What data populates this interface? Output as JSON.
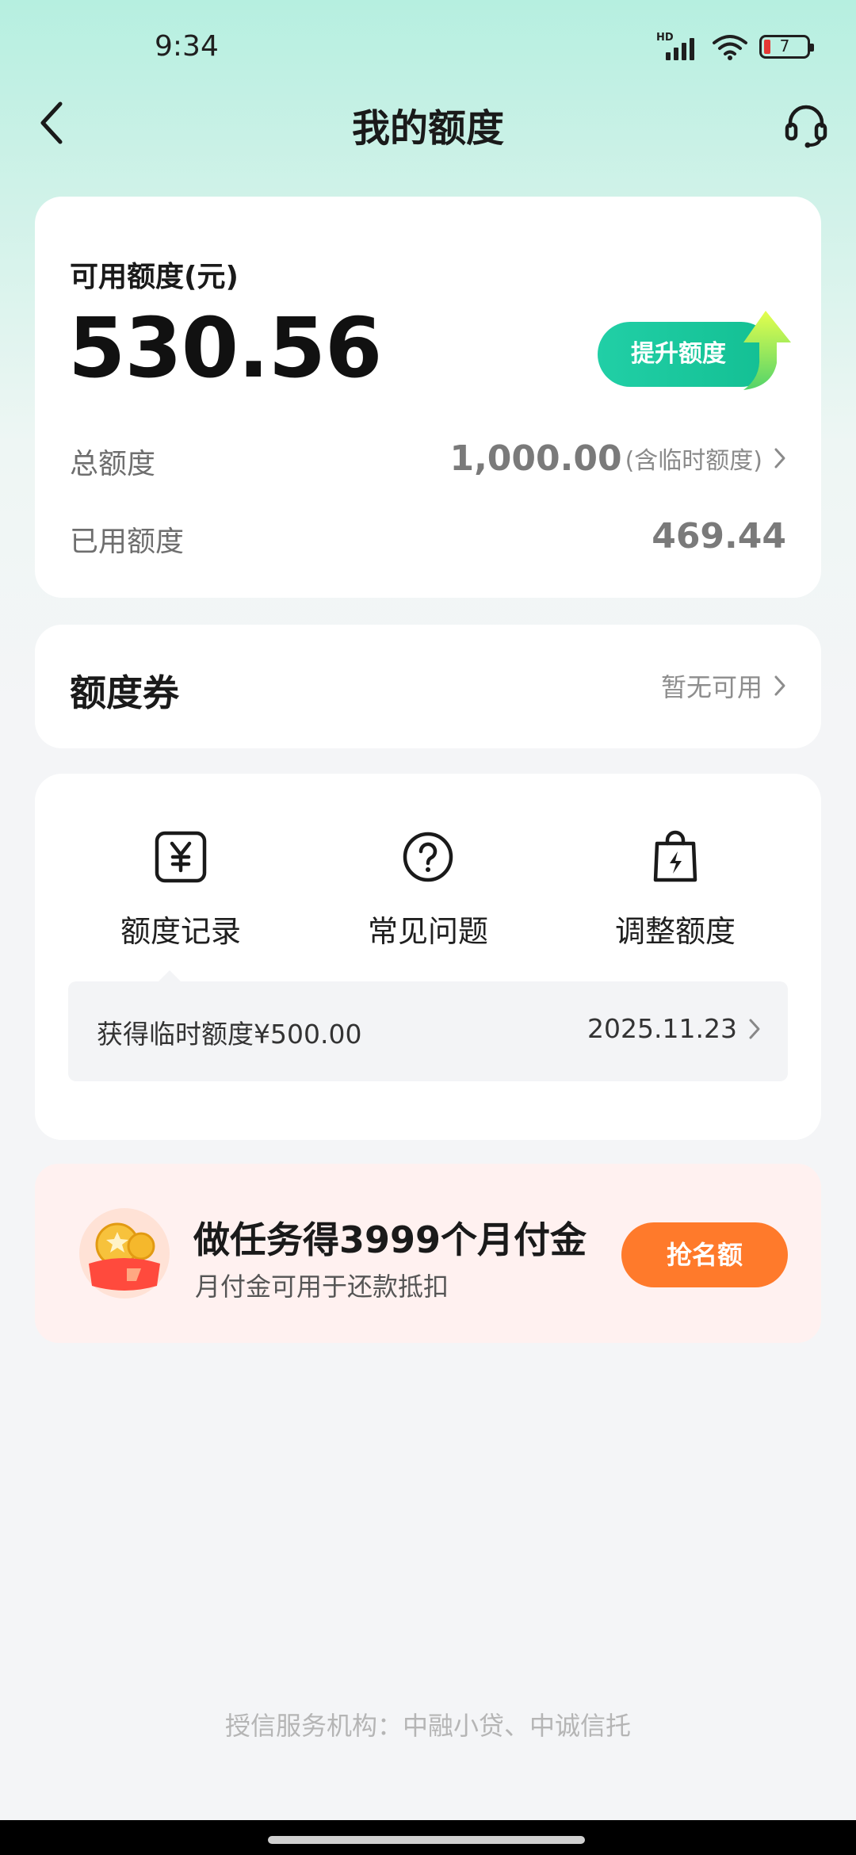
{
  "status_bar": {
    "time": "9:34",
    "network_label": "HD",
    "battery_level": "7",
    "battery_color": "#e53935"
  },
  "nav": {
    "title": "我的额度",
    "back_icon": "chevron-left-icon",
    "service_icon": "headset-icon"
  },
  "quota": {
    "label": "可用额度(元)",
    "available": "530.56",
    "raise_button": "提升额度",
    "total_label": "总额度",
    "total_value": "1,000.00",
    "total_note": "(含临时额度)",
    "used_label": "已用额度",
    "used_value": "469.44"
  },
  "coupon": {
    "title": "额度券",
    "status": "暂无可用"
  },
  "menu": {
    "items": [
      {
        "label": "额度记录",
        "icon": "yen-box-icon"
      },
      {
        "label": "常见问题",
        "icon": "question-circle-icon"
      },
      {
        "label": "调整额度",
        "icon": "bolt-bag-icon"
      }
    ],
    "record": {
      "text": "获得临时额度¥500.00",
      "date": "2025.11.23"
    }
  },
  "promo": {
    "title": "做任务得3999个月付金",
    "subtitle": "月付金可用于还款抵扣",
    "button": "抢名额",
    "accent_color": "#ff7a2b",
    "icon": "coin-wallet-icon"
  },
  "footer": {
    "note": "授信服务机构：中融小贷、中诚信托"
  },
  "colors": {
    "brand_green": "#1cc79d",
    "header_mint": "#b6efe0"
  }
}
